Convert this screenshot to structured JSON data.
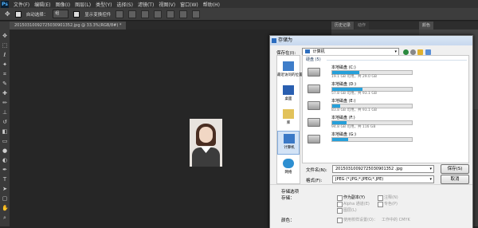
{
  "app": {
    "logo": "Ps",
    "menu": [
      "文件(F)",
      "编辑(E)",
      "图像(I)",
      "图层(L)",
      "类型(Y)",
      "选择(S)",
      "滤镜(T)",
      "视图(V)",
      "窗口(W)",
      "帮助(H)"
    ]
  },
  "options_bar": {
    "auto_select_label": "自动选择：",
    "auto_select_value": "组",
    "show_transform_label": "显示变换控件"
  },
  "document": {
    "tab_title": "20150310092725030901352.jpg @ 33.3%(RGB/8#) *"
  },
  "panels": {
    "tab1": "历史记录",
    "tab2": "动作",
    "tab3": "颜色"
  },
  "dialog": {
    "title": "存储为",
    "save_in_label": "保存在(I):",
    "save_in_value": "计算机",
    "places": [
      {
        "label": "最近访问的位置"
      },
      {
        "label": "桌面"
      },
      {
        "label": "库"
      },
      {
        "label": "计算机"
      },
      {
        "label": "网络"
      }
    ],
    "group_header": "硬盘 (5)",
    "drives": [
      {
        "name": "本地磁盘 (C:)",
        "free": "19.1 GB 可用，共 29.0 GB",
        "used_fraction": 0.34
      },
      {
        "name": "本地磁盘 (D:)",
        "free": "57.8 GB 可用，共 93.1 GB",
        "used_fraction": 0.38
      },
      {
        "name": "本地磁盘 (E:)",
        "free": "83.8 GB 可用，共 93.1 GB",
        "used_fraction": 0.1
      },
      {
        "name": "本地磁盘 (F:)",
        "free": "94.8 GB 可用，共 116 GB",
        "used_fraction": 0.18
      },
      {
        "name": "本地磁盘 (G:)",
        "free": "",
        "used_fraction": 0.2
      }
    ],
    "filename_label": "文件名(N):",
    "filename_value": "20150310092725030901352 .jpg",
    "format_label": "格式(F):",
    "format_value": "JPEG (*.JPG;*.JPEG;*.JPE)",
    "save_button": "保存(S)",
    "cancel_button": "取消",
    "options_header": "存储选项",
    "options_save_label": "存储：",
    "opt_copy": "作为副本(Y)",
    "opt_alpha": "Alpha 通道(E)",
    "opt_layers": "图层(L)",
    "opt_notes": "注释(N)",
    "opt_spot": "专色(P)",
    "color_label": "颜色：",
    "opt_proof": "使用校样设置(O)：",
    "opt_proof_value": "工作中的 CMYK"
  }
}
